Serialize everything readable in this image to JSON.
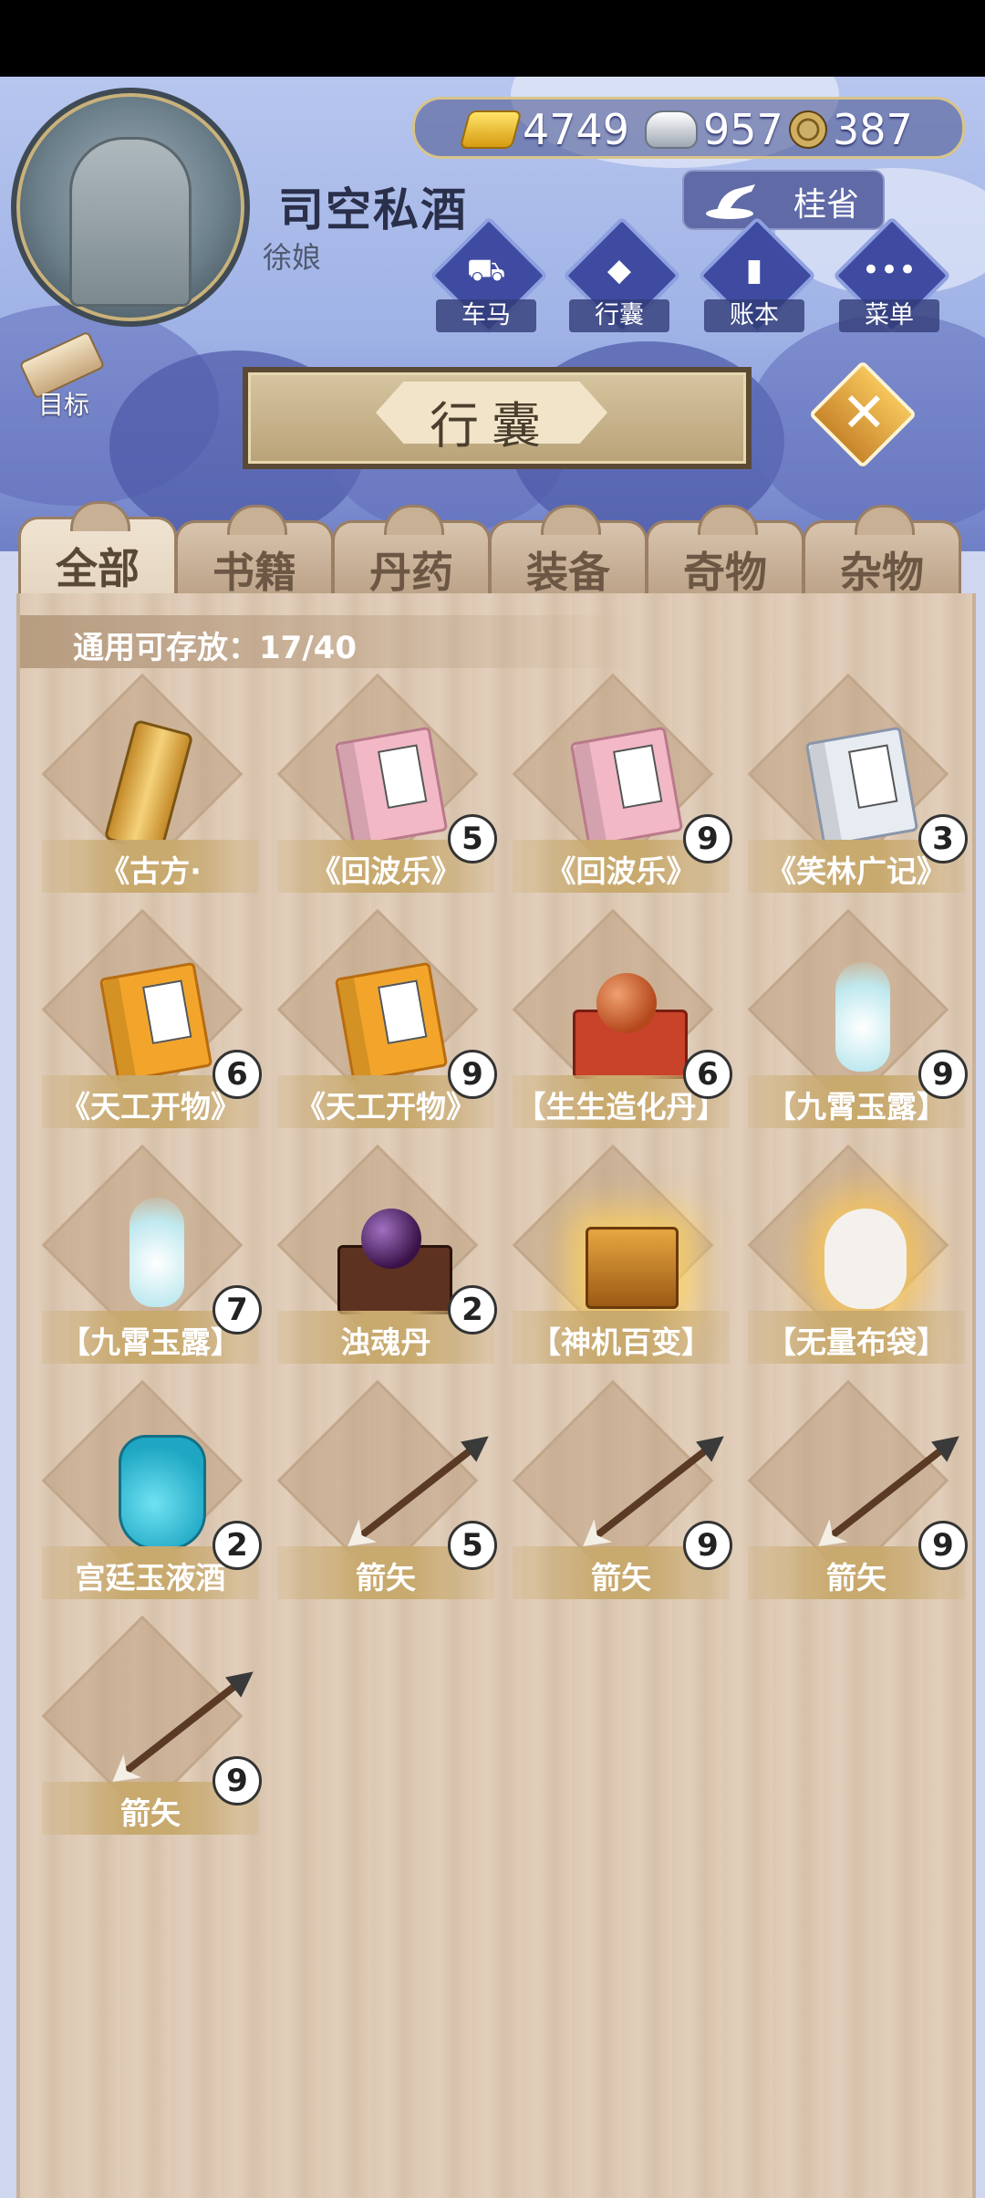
{
  "player": {
    "name": "司空私酒",
    "title": "徐娘"
  },
  "currency": {
    "gold": "4749",
    "silver": "957",
    "copper": "387"
  },
  "location": {
    "label": "桂省"
  },
  "menu": [
    {
      "label": "车马",
      "icon": "carriage-icon"
    },
    {
      "label": "行囊",
      "icon": "bundle-icon"
    },
    {
      "label": "账本",
      "icon": "ledger-icon"
    },
    {
      "label": "菜单",
      "icon": "more-icon"
    }
  ],
  "goal": {
    "label": "目标"
  },
  "window": {
    "title": "行囊",
    "close_symbol": "✕"
  },
  "tabs": [
    "全部",
    "书籍",
    "丹药",
    "装备",
    "奇物",
    "杂物"
  ],
  "active_tab": "全部",
  "capacity": {
    "text": "通用可存放：17/40",
    "used": 17,
    "max": 40
  },
  "items": [
    {
      "name": "《古方·",
      "count": "",
      "icon": "golden-scroll"
    },
    {
      "name": "《回波乐》",
      "count": "5",
      "icon": "pink-book"
    },
    {
      "name": "《回波乐》",
      "count": "9",
      "icon": "pink-book"
    },
    {
      "name": "《笑林广记》",
      "count": "3",
      "icon": "white-book"
    },
    {
      "name": "《天工开物》",
      "count": "6",
      "icon": "orange-book"
    },
    {
      "name": "《天工开物》",
      "count": "9",
      "icon": "orange-book"
    },
    {
      "name": "【生生造化丹】",
      "count": "6",
      "icon": "red-pill-box"
    },
    {
      "name": "【九霄玉露】",
      "count": "9",
      "icon": "jade-vase"
    },
    {
      "name": "【九霄玉露】",
      "count": "7",
      "icon": "jade-vase"
    },
    {
      "name": "浊魂丹",
      "count": "2",
      "icon": "dark-pill-box"
    },
    {
      "name": "【神机百变】",
      "count": "",
      "icon": "golden-chest"
    },
    {
      "name": "【无量布袋】",
      "count": "",
      "icon": "cloth-bag"
    },
    {
      "name": "宫廷玉液酒",
      "count": "2",
      "icon": "teapot"
    },
    {
      "name": "箭矢",
      "count": "5",
      "icon": "arrow"
    },
    {
      "name": "箭矢",
      "count": "9",
      "icon": "arrow"
    },
    {
      "name": "箭矢",
      "count": "9",
      "icon": "arrow"
    },
    {
      "name": "箭矢",
      "count": "9",
      "icon": "arrow"
    }
  ]
}
